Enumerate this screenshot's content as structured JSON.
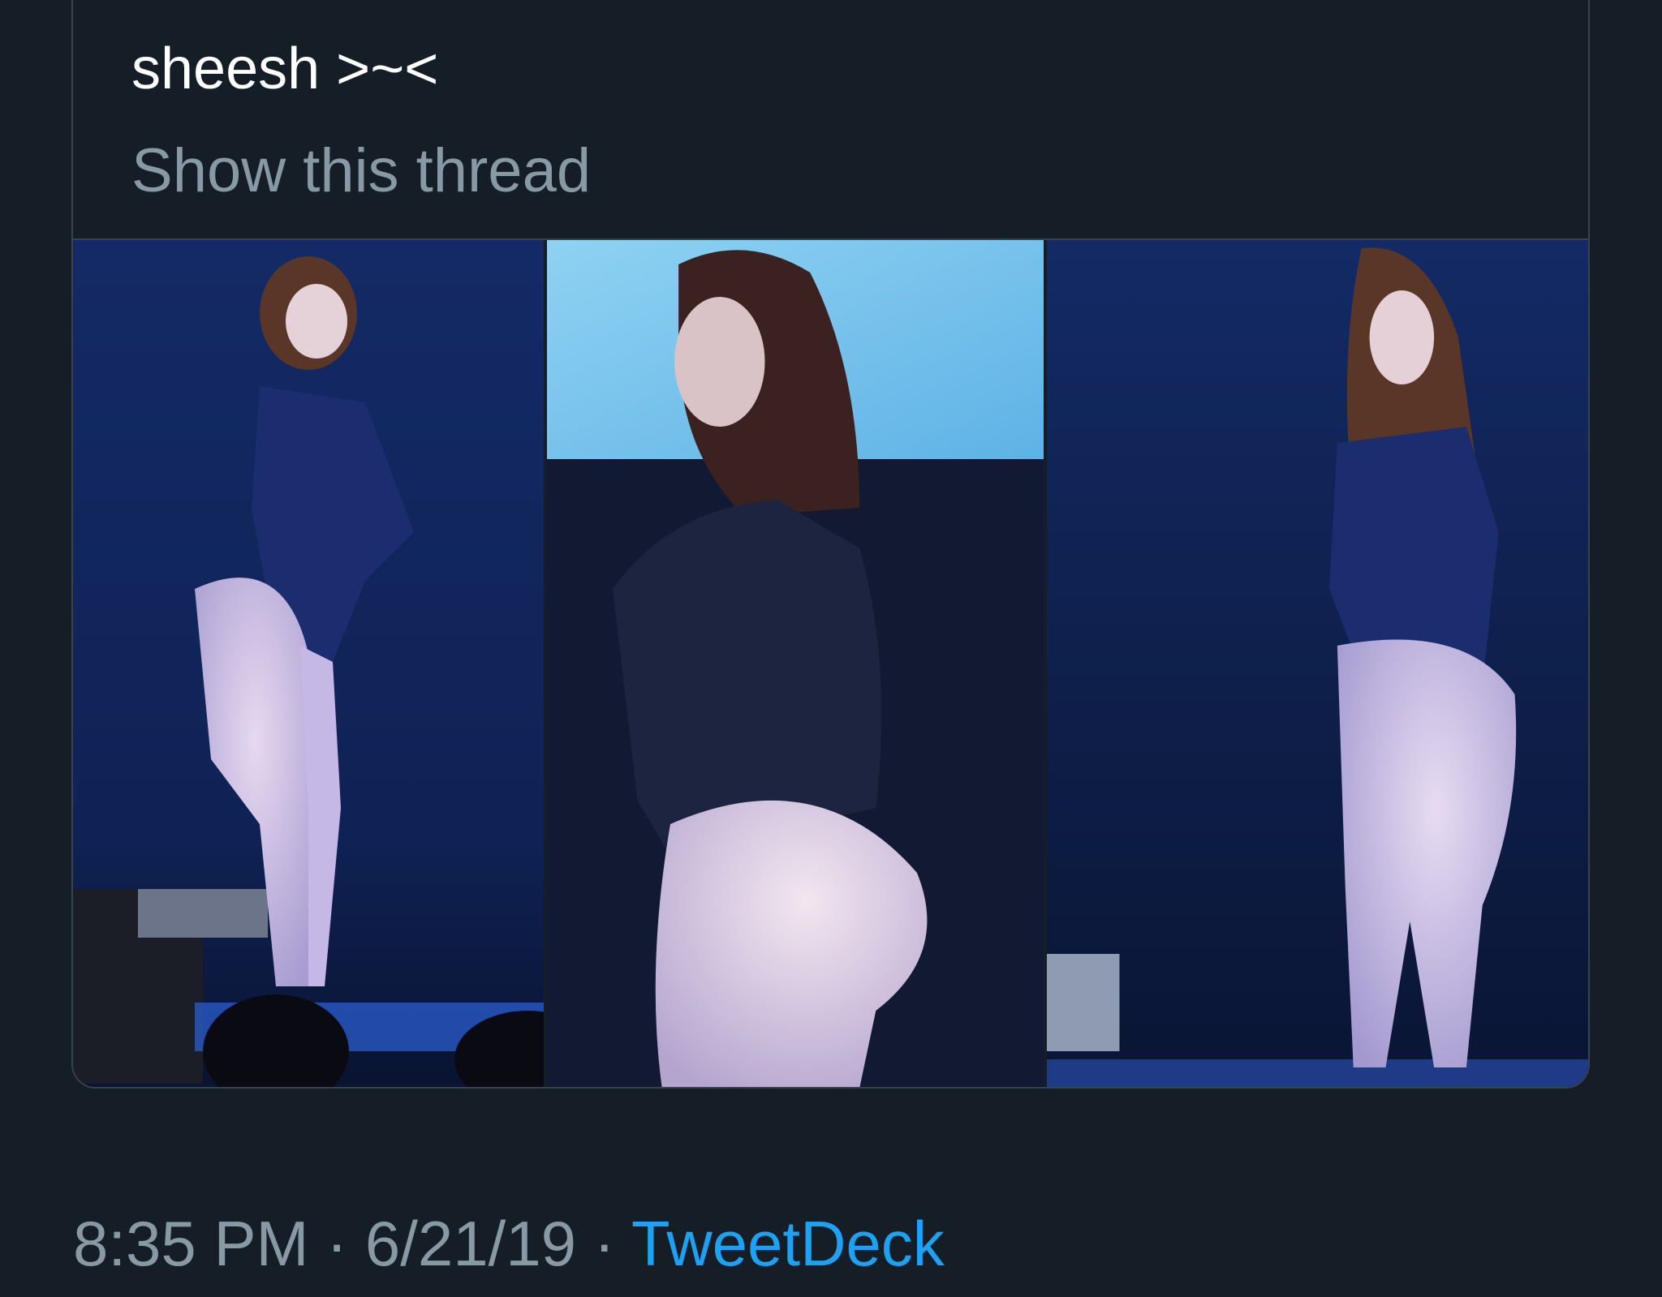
{
  "quoted_tweet": {
    "text": "sheesh >~<",
    "show_thread_label": "Show this thread",
    "photos": [
      {
        "alt": "photo-1"
      },
      {
        "alt": "photo-2"
      },
      {
        "alt": "photo-3"
      }
    ]
  },
  "meta": {
    "time": "8:35 PM",
    "separator_1": " · ",
    "date": "6/21/19",
    "separator_2": " · ",
    "source": "TweetDeck"
  },
  "colors": {
    "background": "#151e27",
    "text_primary": "#ffffff",
    "text_secondary": "#8899a6",
    "link": "#1da1f2",
    "border": "#38444d"
  }
}
